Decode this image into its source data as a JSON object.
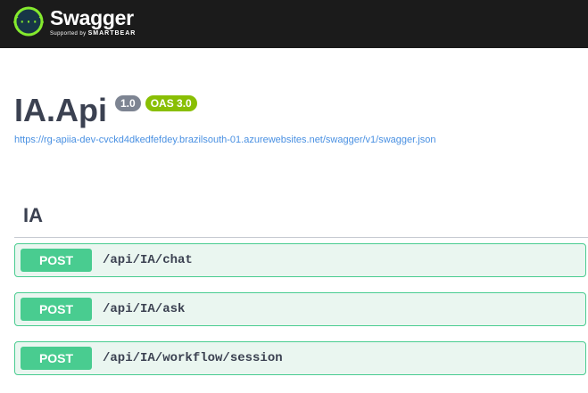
{
  "topbar": {
    "logo_title": "Swagger",
    "logo_supported_by": "Supported by",
    "logo_brand": "SMARTBEAR",
    "logo_icon": "swagger-logo-icon"
  },
  "info": {
    "title": "IA.Api",
    "version": "1.0",
    "oas": "OAS 3.0",
    "spec_url": "https://rg-apiia-dev-cvckd4dkedfefdey.brazilsouth-01.azurewebsites.net/swagger/v1/swagger.json"
  },
  "tag": {
    "name": "IA"
  },
  "operations": [
    {
      "method": "POST",
      "path": "/api/IA/chat"
    },
    {
      "method": "POST",
      "path": "/api/IA/ask"
    },
    {
      "method": "POST",
      "path": "/api/IA/workflow/session"
    }
  ],
  "colors": {
    "topbar_bg": "#1b1b1b",
    "logo_green": "#85ea2d",
    "post_green": "#49cc90",
    "post_bg": "#eaf6f0",
    "link": "#4990e2",
    "version_badge": "#7d8492",
    "oas_badge": "#89bf04"
  }
}
